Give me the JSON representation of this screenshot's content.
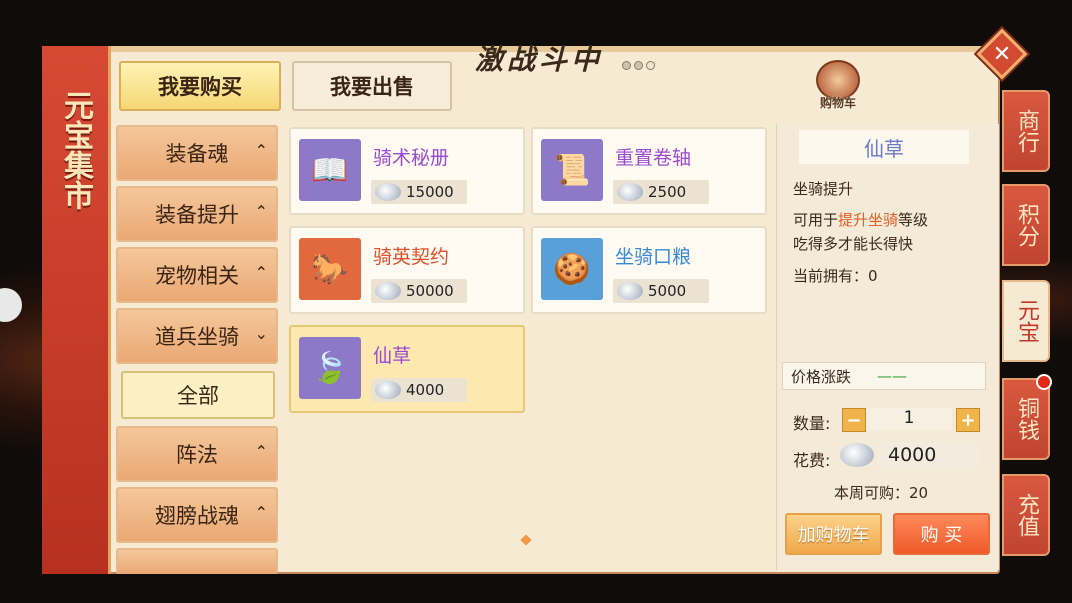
{
  "banner": {
    "title": "元宝集市"
  },
  "logo": {
    "text": "激战斗中"
  },
  "close_label": "✕",
  "cart": {
    "label": "购物车"
  },
  "top_tabs": {
    "buy": "我要购买",
    "sell": "我要出售"
  },
  "categories": [
    {
      "label": "装备魂",
      "arrow": "⌃"
    },
    {
      "label": "装备提升",
      "arrow": "⌃"
    },
    {
      "label": "宠物相关",
      "arrow": "⌃"
    },
    {
      "label": "道兵坐骑",
      "arrow": "⌄"
    },
    {
      "label": "全部"
    },
    {
      "label": "阵法",
      "arrow": "⌃"
    },
    {
      "label": "翅膀战魂",
      "arrow": "⌃"
    }
  ],
  "items": [
    {
      "name": "骑术秘册",
      "price": "15000",
      "name_color": "#9a4ad0",
      "icon": "book-icon"
    },
    {
      "name": "重置卷轴",
      "price": "2500",
      "name_color": "#9a4ad0",
      "icon": "scroll-icon"
    },
    {
      "name": "骑英契约",
      "price": "50000",
      "name_color": "#e0502a",
      "icon": "horse-icon"
    },
    {
      "name": "坐骑口粮",
      "price": "5000",
      "name_color": "#3a8ad8",
      "icon": "biscuit-icon"
    },
    {
      "name": "仙草",
      "price": "4000",
      "name_color": "#9a4ad0",
      "icon": "leaf-icon"
    }
  ],
  "detail": {
    "name": "仙草",
    "subtitle": "坐骑提升",
    "desc_prefix": "可用于",
    "desc_highlight": "提升坐骑",
    "desc_suffix": "等级",
    "desc2": "吃得多才能长得快",
    "owned": "当前拥有：0",
    "trend_label": "价格涨跌",
    "trend_value": "——",
    "qty_label": "数量:",
    "qty_minus": "−",
    "qty": "1",
    "qty_plus": "+",
    "cost_label": "花费:",
    "cost": "4000",
    "weekly": "本周可购：20",
    "add_cart": "加购物车",
    "buy": "购 买"
  },
  "right_tabs": [
    "商行",
    "积分",
    "元宝",
    "铜钱",
    "充值"
  ],
  "colors": {
    "accent_red": "#c14431",
    "gold": "#f5d774"
  }
}
